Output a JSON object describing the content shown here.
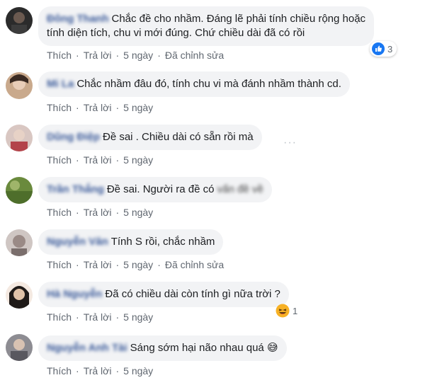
{
  "comments": [
    {
      "name": "Đông Thanh",
      "text_line1": "Chắc đề cho nhầm. Đáng lẽ phải tính chiều rộng hoặc",
      "text_line2": "tính diện tích, chu vi mới đúng. Chứ chiều dài đã có rồi",
      "actions": {
        "like": "Thích",
        "reply": "Trả lời",
        "time": "5 ngày",
        "edited": "Đã chỉnh sửa"
      },
      "reaction": {
        "icon": "like-icon",
        "count": "3"
      },
      "avatar_color": "#2b2b2b"
    },
    {
      "name": "Mi La",
      "text": "Chắc nhầm đâu đó, tính chu vi mà đánh nhầm thành cd.",
      "actions": {
        "like": "Thích",
        "reply": "Trả lời",
        "time": "5 ngày"
      },
      "avatar_color": "#c9a98c"
    },
    {
      "name": "Dũng Điệp",
      "text": "Đề sai . Chiều dài có sẵn rồi mà",
      "actions": {
        "like": "Thích",
        "reply": "Trả lời",
        "time": "5 ngày"
      },
      "more": "···",
      "avatar_color": "#b3434a"
    },
    {
      "name": "Trần Thắng",
      "text": "Đề sai. Người ra đề có",
      "text_hidden": "vấn đề về",
      "actions": {
        "like": "Thích",
        "reply": "Trả lời",
        "time": "5 ngày"
      },
      "avatar_color": "#6a8a3d"
    },
    {
      "name": "Nguyễn Văn",
      "text": "Tính S rồi, chắc nhầm",
      "actions": {
        "like": "Thích",
        "reply": "Trả lời",
        "time": "5 ngày",
        "edited": "Đã chỉnh sửa"
      },
      "avatar_color": "#9a8a86"
    },
    {
      "name": "Hà Nguyễn",
      "text": "Đã có chiều dài còn tính gì nữa trời ?",
      "actions": {
        "like": "Thích",
        "reply": "Trả lời",
        "time": "5 ngày"
      },
      "reaction": {
        "icon": "haha-icon",
        "count": "1"
      },
      "avatar_color": "#e0c2a8"
    },
    {
      "name": "Nguyễn Anh Tài",
      "text": "Sáng sớm hại não nhau quá",
      "emoji": "😅",
      "actions": {
        "like": "Thích",
        "reply": "Trả lời",
        "time": "5 ngày"
      },
      "avatar_color": "#59585f"
    }
  ],
  "colors": {
    "name": "#385898",
    "bubble": "#f2f3f5",
    "meta": "#606770",
    "like_blue": "#1877f2",
    "haha_yellow": "#f7b125"
  }
}
